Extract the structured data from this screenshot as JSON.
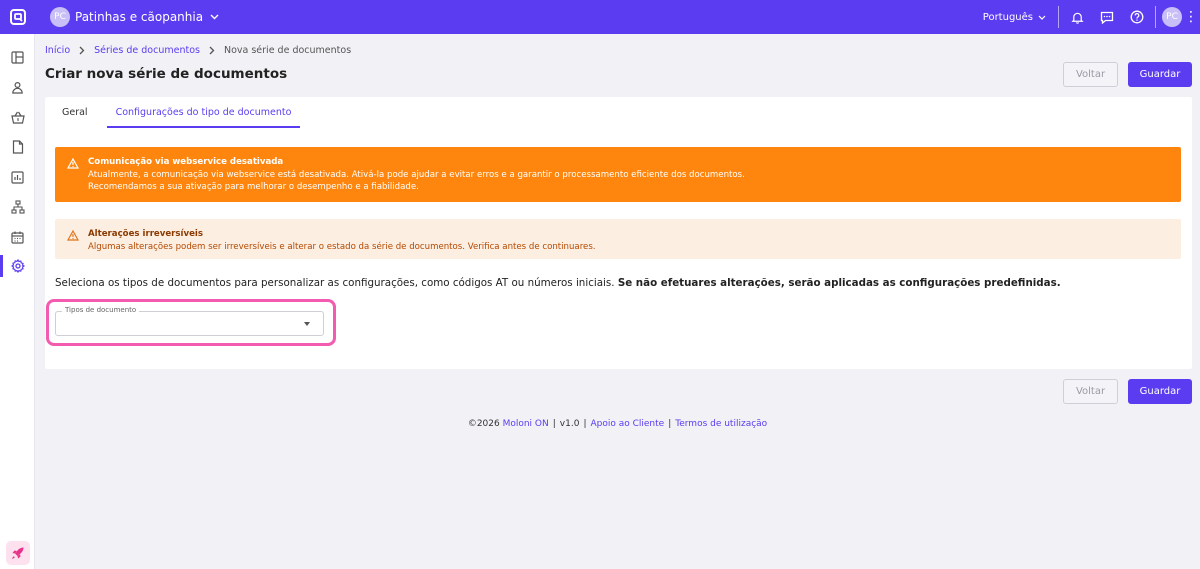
{
  "topbar": {
    "company_initials": "PC",
    "company_name": "Patinhas e cãopanhia",
    "language": "Português",
    "user_initials": "PC"
  },
  "sidebar": {
    "items": [
      {
        "icon": "dashboard-icon"
      },
      {
        "icon": "user-icon"
      },
      {
        "icon": "basket-icon"
      },
      {
        "icon": "document-icon"
      },
      {
        "icon": "chart-icon"
      },
      {
        "icon": "workflow-icon"
      },
      {
        "icon": "calendar-icon"
      },
      {
        "icon": "settings-icon",
        "active": true
      }
    ],
    "bottom_icon": "rocket-icon"
  },
  "breadcrumb": {
    "home": "Início",
    "series": "Séries de documentos",
    "current": "Nova série de documentos"
  },
  "page": {
    "title": "Criar nova série de documentos",
    "back_label": "Voltar",
    "save_label": "Guardar"
  },
  "tabs": [
    {
      "label": "Geral",
      "active": false
    },
    {
      "label": "Configurações do tipo de documento",
      "active": true
    }
  ],
  "alerts": {
    "webservice": {
      "title": "Comunicação via webservice desativada",
      "line1": "Atualmente, a comunicação via webservice está desativada. Ativá-la pode ajudar a evitar erros e a garantir o processamento eficiente dos documentos.",
      "line2": "Recomendamos a sua ativação para melhorar o desempenho e a fiabilidade."
    },
    "irreversible": {
      "title": "Alterações irreversíveis",
      "line1": "Algumas alterações podem ser irreversíveis e alterar o estado da série de documentos. Verifica antes de continuares."
    }
  },
  "description": {
    "normal": "Seleciona os tipos de documentos para personalizar as configurações, como códigos AT ou números iniciais. ",
    "bold": "Se não efetuares alterações, serão aplicadas as configurações predefinidas."
  },
  "select": {
    "label": "Tipos de documento",
    "value": ""
  },
  "footer": {
    "copyright": "©2026 ",
    "brand": "Moloni ON",
    "version": "v1.0",
    "support": "Apoio ao Cliente",
    "terms": "Termos de utilização"
  },
  "colors": {
    "primary": "#5b3cf0",
    "warning": "#ff860e",
    "warning_soft": "#fdeee2",
    "highlight": "#f25bb0"
  }
}
